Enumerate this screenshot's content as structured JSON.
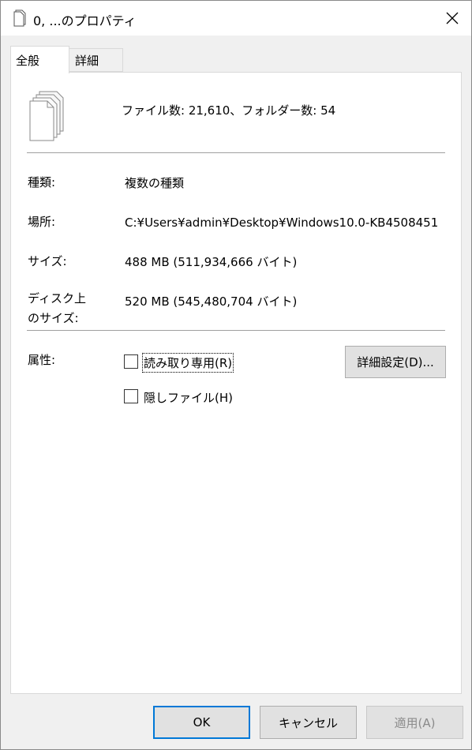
{
  "window": {
    "title": "0, ...のプロパティ"
  },
  "tabs": [
    {
      "label": "全般",
      "active": true
    },
    {
      "label": "詳細",
      "active": false
    }
  ],
  "summary": {
    "text": "ファイル数: 21,610、フォルダー数: 54",
    "icon": "multiple-files-icon"
  },
  "properties": {
    "type_label": "種類:",
    "type_value": "複数の種類",
    "location_label": "場所:",
    "location_value": "C:¥Users¥admin¥Desktop¥Windows10.0-KB4508451",
    "size_label": "サイズ:",
    "size_value": "488 MB (511,934,666 バイト)",
    "disk_label_line1": "ディスク上",
    "disk_label_line2": "のサイズ:",
    "disk_value": "520 MB (545,480,704 バイト)"
  },
  "attributes": {
    "label": "属性:",
    "readonly_label": "読み取り専用(R)",
    "readonly_checked": false,
    "hidden_label": "隠しファイル(H)",
    "hidden_checked": false,
    "advanced_button": "詳細設定(D)..."
  },
  "buttons": {
    "ok": "OK",
    "cancel": "キャンセル",
    "apply": "適用(A)"
  }
}
